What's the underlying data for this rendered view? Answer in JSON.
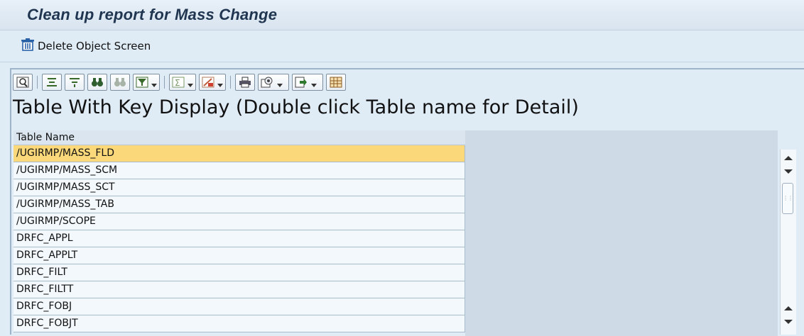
{
  "window": {
    "title": "Clean up report for Mass Change"
  },
  "appbar": {
    "delete_button": {
      "label": "Delete Object Screen",
      "icon": "trash-icon"
    }
  },
  "toolbar": {
    "buttons": [
      {
        "name": "details-button",
        "icon": "magnifier-details-icon"
      },
      {
        "name": "sort-ascending-button",
        "icon": "sort-ascending-icon"
      },
      {
        "name": "sort-descending-button",
        "icon": "sort-descending-icon"
      },
      {
        "name": "find-button",
        "icon": "binoculars-icon"
      },
      {
        "name": "find-next-button",
        "icon": "binoculars-next-icon"
      },
      {
        "name": "filter-button",
        "icon": "filter-icon"
      },
      {
        "name": "sum-button",
        "icon": "sigma-icon"
      },
      {
        "name": "subtotal-button",
        "icon": "subtotal-icon"
      },
      {
        "name": "print-button",
        "icon": "printer-icon"
      },
      {
        "name": "views-button",
        "icon": "views-icon"
      },
      {
        "name": "export-button",
        "icon": "export-icon"
      },
      {
        "name": "layout-button",
        "icon": "grid-layout-icon"
      }
    ]
  },
  "heading": "Table With Key Display (Double click Table name for Detail)",
  "table": {
    "column_header": "Table Name",
    "rows": [
      "/UGIRMP/MASS_FLD",
      "/UGIRMP/MASS_SCM",
      "/UGIRMP/MASS_SCT",
      "/UGIRMP/MASS_TAB",
      "/UGIRMP/SCOPE",
      "DRFC_APPL",
      "DRFC_APPLT",
      "DRFC_FILT",
      "DRFC_FILTT",
      "DRFC_FOBJ",
      "DRFC_FOBJT"
    ],
    "selected_row": 0
  },
  "colors": {
    "selected_row": "#fbd87a",
    "row_background": "#f3f8fc",
    "title_text": "#1f3550",
    "screen_background": "#dfebf5"
  }
}
